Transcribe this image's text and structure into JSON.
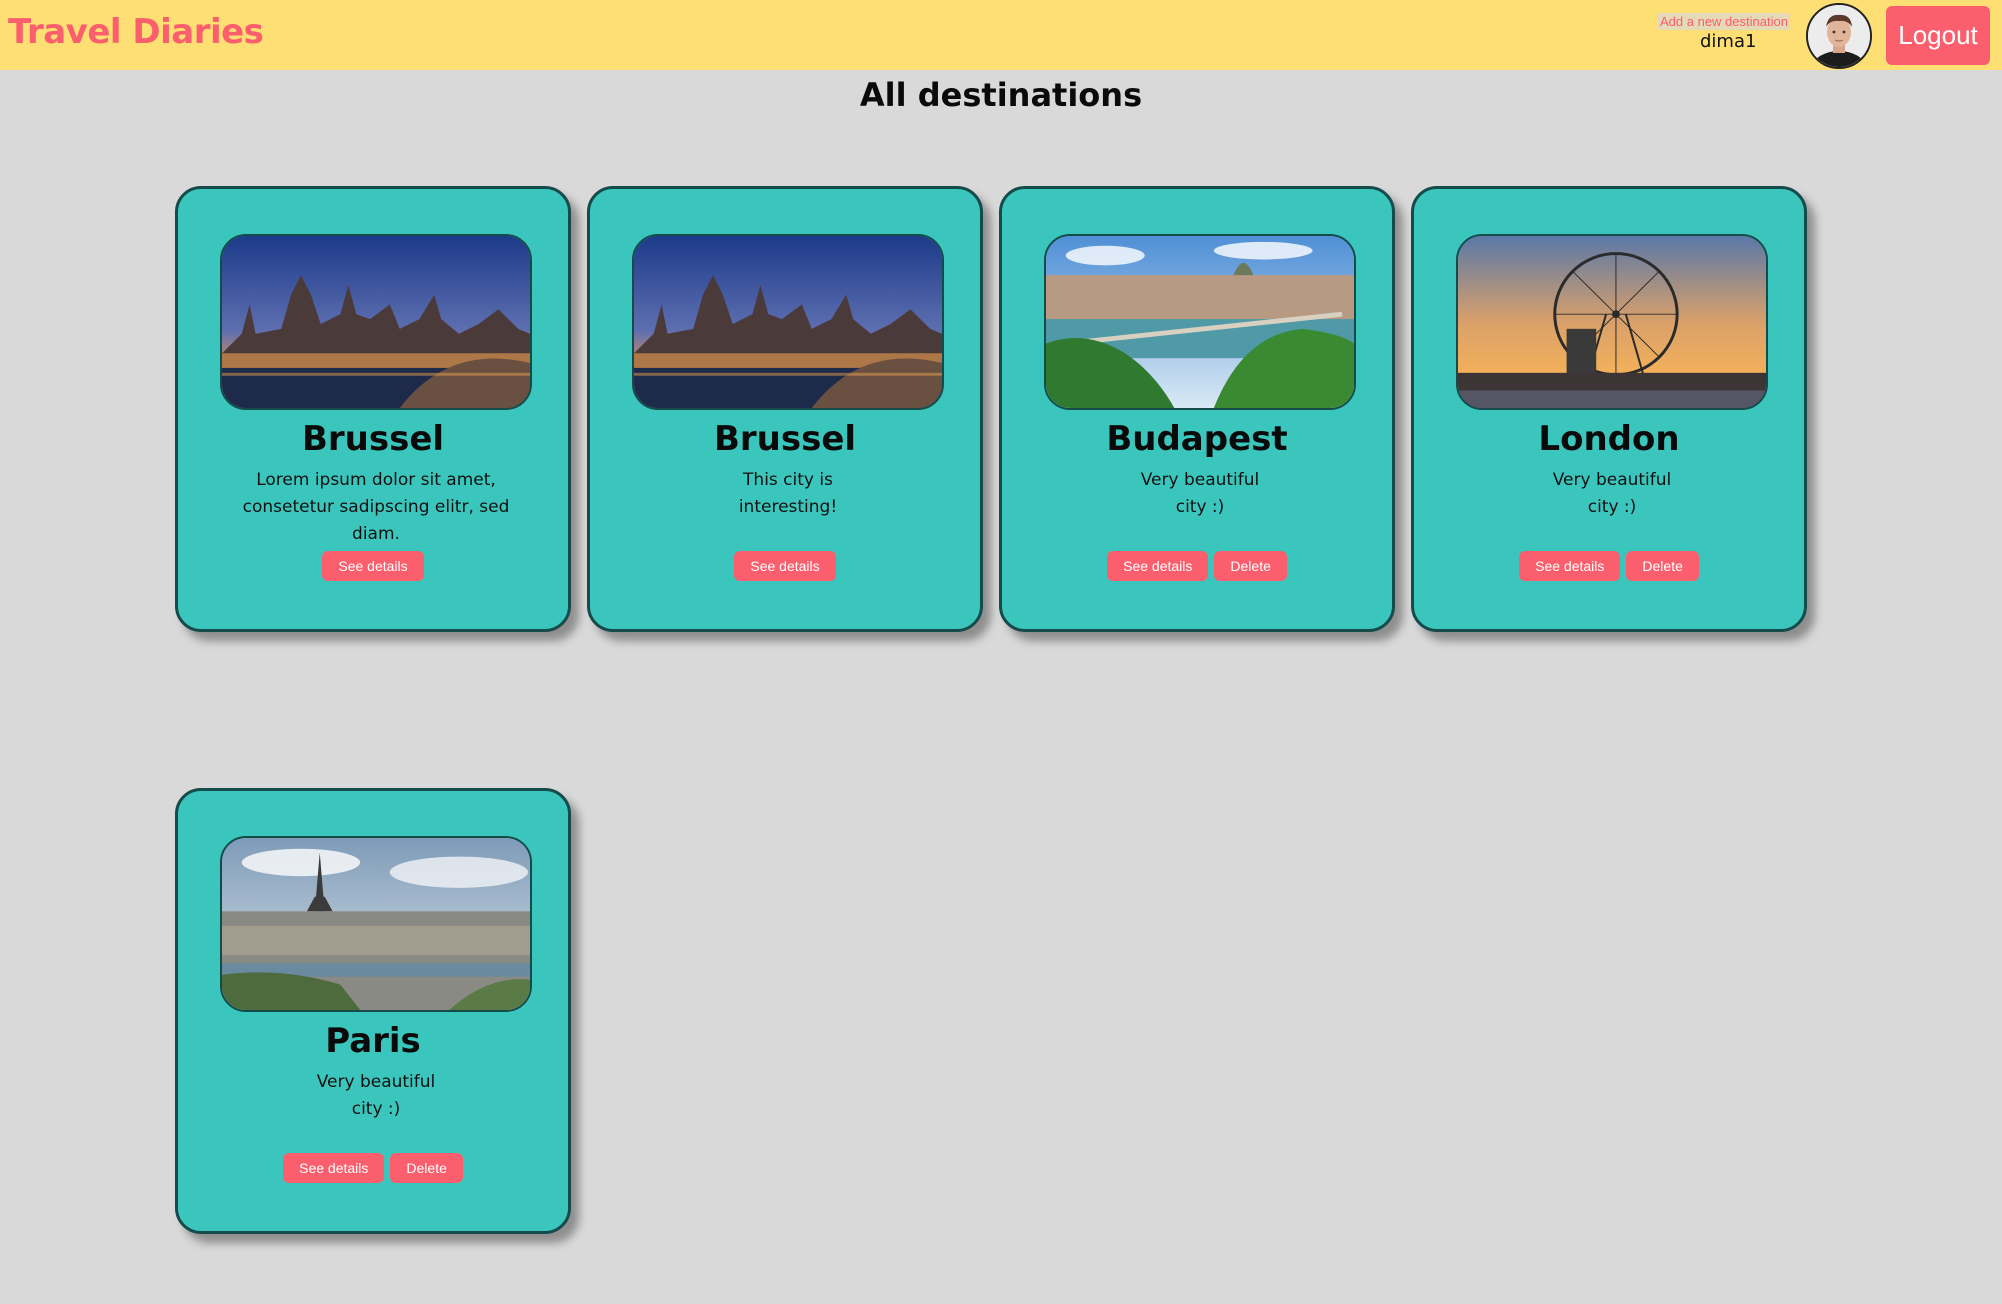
{
  "navbar": {
    "brand": "Travel Diaries",
    "add_destination_link": "Add a new destination",
    "username": "dima1",
    "logout_label": "Logout"
  },
  "page": {
    "title": "All destinations"
  },
  "destinations": [
    {
      "name": "Brussel",
      "description": "Lorem ipsum dolor sit amet, consetetur sadipscing elitr, sed diam.",
      "photo": "brussel-canal-night",
      "see_details_label": "See details",
      "delete_label": ""
    },
    {
      "name": "Brussel",
      "description": "This city is interesting!",
      "photo": "brussel-canal-night",
      "see_details_label": "See details",
      "delete_label": ""
    },
    {
      "name": "Budapest",
      "description": "Very beautiful city :)",
      "photo": "budapest-chain-bridge",
      "see_details_label": "See details",
      "delete_label": "Delete"
    },
    {
      "name": "London",
      "description": "Very beautiful city :)",
      "photo": "london-eye-sunset",
      "see_details_label": "See details",
      "delete_label": "Delete"
    },
    {
      "name": "Paris",
      "description": "Very beautiful city :)",
      "photo": "paris-eiffel-tower",
      "see_details_label": "See details",
      "delete_label": "Delete"
    }
  ],
  "colors": {
    "navbar": "#fedf73",
    "accent": "#fb5e6c",
    "card": "#3bc6bd",
    "card_border": "#164b4b",
    "background": "#d9d9d9"
  }
}
